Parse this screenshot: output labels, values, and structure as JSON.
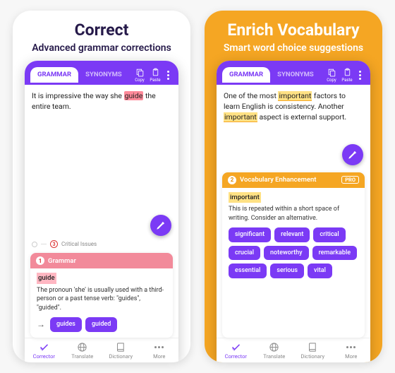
{
  "left": {
    "title": "Correct",
    "subtitle": "Advanced grammar corrections",
    "topbar": {
      "tabs": [
        "GRAMMAR",
        "SYNONYMS"
      ],
      "copy": "Copy",
      "paste": "Paste"
    },
    "editor_pre": "It is impressive the way she ",
    "editor_err": "guide",
    "editor_post": " the entire team.",
    "issues_label": "Critical Issues",
    "issues_count": "3",
    "card": {
      "idx": "1",
      "title": "Grammar",
      "key": "guide",
      "body": "The pronoun 'she' is usually used with a third-person or a past tense verb: \"guides\", \"guided\".",
      "chips": [
        "guides",
        "guided"
      ]
    },
    "nav": [
      "Corrector",
      "Translate",
      "Dictionary",
      "More"
    ]
  },
  "right": {
    "title": "Enrich Vocabulary",
    "subtitle": "Smart word choice suggestions",
    "topbar": {
      "tabs": [
        "GRAMMAR",
        "SYNONYMS"
      ],
      "copy": "Copy",
      "paste": "Paste"
    },
    "editor_p1": "One of the most ",
    "editor_w1": "important",
    "editor_p2": " factors to learn English is consistency. Another ",
    "editor_w2": "important",
    "editor_p3": " aspect is external support.",
    "card": {
      "idx": "2",
      "title": "Vocabulary Enhancement",
      "pro": "PRO",
      "key": "important",
      "body": "This is repeated within a short space of writing. Consider an alternative.",
      "chips": [
        "significant",
        "relevant",
        "critical",
        "crucial",
        "noteworthy",
        "remarkable",
        "essential",
        "serious",
        "vital"
      ]
    },
    "nav": [
      "Corrector",
      "Translate",
      "Dictionary",
      "More"
    ]
  }
}
